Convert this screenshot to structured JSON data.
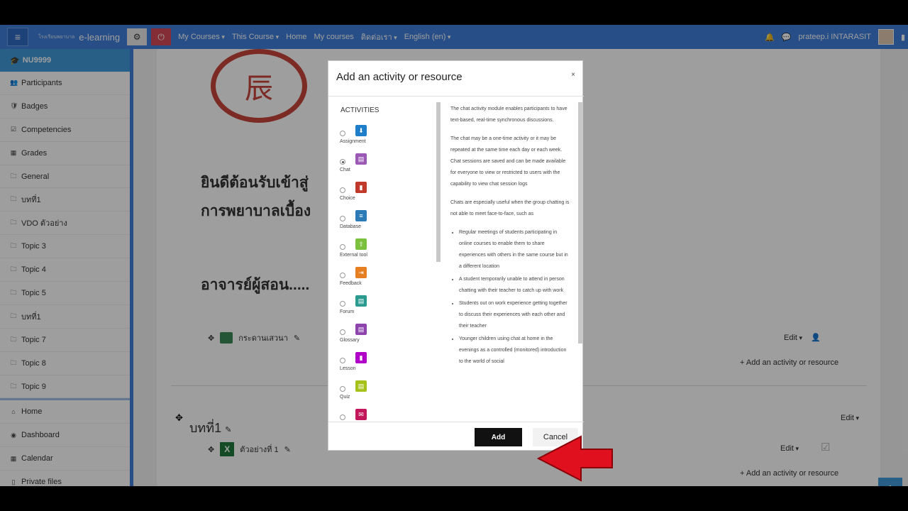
{
  "navbar": {
    "brand_small": "โรงเรียนพยาบาล",
    "brand": "e-learning",
    "menu": [
      "My Courses",
      "This Course",
      "Home",
      "My courses",
      "ติดต่อเรา",
      "English (en)"
    ],
    "user": "prateep.i INTARASIT"
  },
  "sidebar": {
    "course": "NU9999",
    "items": [
      "Participants",
      "Badges",
      "Competencies",
      "Grades",
      "General",
      "บทที่1",
      "VDO ตัวอย่าง",
      "Topic 3",
      "Topic 4",
      "Topic 5",
      "บทที่1",
      "Topic 7",
      "Topic 8",
      "Topic 9"
    ],
    "items2": [
      "Home",
      "Dashboard",
      "Calendar",
      "Private files"
    ]
  },
  "main": {
    "logo_text": "辰",
    "title_line1": "ยินดีต้อนรับเข้าสู่",
    "title_line2": "การพยาบาลเบื้อง",
    "teacher": "อาจารย์ผู้สอน.....",
    "forum_label": "กระดานเสวนา",
    "edit1": "Edit",
    "add1": "Add an activity or resource",
    "section_title": "บทที่1",
    "edit2": "Edit",
    "file_label": "ตัวอย่างที่ 1",
    "edit3": "Edit",
    "add2": "Add an activity or resource"
  },
  "modal": {
    "title": "Add an activity or resource",
    "close": "×",
    "activities_heading": "ACTIVITIES",
    "activities": [
      {
        "label": "Assignment",
        "color": "#1e7ec9",
        "selected": false
      },
      {
        "label": "Chat",
        "color": "#9b59b6",
        "selected": true
      },
      {
        "label": "Choice",
        "color": "#c0392b",
        "selected": false
      },
      {
        "label": "Database",
        "color": "#2c7bb6",
        "selected": false
      },
      {
        "label": "External tool",
        "color": "#7cc13e",
        "selected": false
      },
      {
        "label": "Feedback",
        "color": "#e67e22",
        "selected": false
      },
      {
        "label": "Forum",
        "color": "#2b9a8f",
        "selected": false
      },
      {
        "label": "Glossary",
        "color": "#8e44ad",
        "selected": false
      },
      {
        "label": "Lesson",
        "color": "#b100c8",
        "selected": false
      },
      {
        "label": "Quiz",
        "color": "#a6c11a",
        "selected": false
      },
      {
        "label": "",
        "color": "#c2185b",
        "selected": false
      }
    ],
    "desc_p1": "The chat activity module enables participants to have text-based, real-time synchronous discussions.",
    "desc_p2": "The chat may be a one-time activity or it may be repeated at the same time each day or each week. Chat sessions are saved and can be made available for everyone to view or restricted to users with the capability to view chat session logs",
    "desc_p3": "Chats are especially useful when the group chatting is not able to meet face-to-face, such as",
    "desc_list": [
      "Regular meetings of students participating in online courses to enable them to share experiences with others in the same course but in a different location",
      "A student temporarily unable to attend in person chatting with their teacher to catch up with work",
      "Students out on work experience getting together to discuss their experiences with each other and their teacher",
      "Younger children using chat at home in the evenings as a controlled (monitored) introduction to the world of social"
    ],
    "add_button": "Add",
    "cancel_button": "Cancel"
  }
}
